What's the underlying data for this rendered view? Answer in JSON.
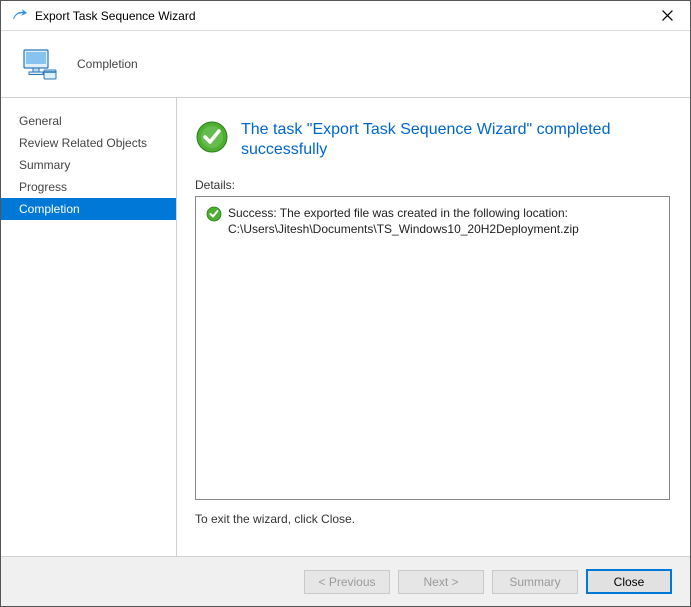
{
  "window": {
    "title": "Export Task Sequence Wizard"
  },
  "header": {
    "stage": "Completion"
  },
  "sidebar": {
    "items": [
      {
        "label": "General"
      },
      {
        "label": "Review Related Objects"
      },
      {
        "label": "Summary"
      },
      {
        "label": "Progress"
      },
      {
        "label": "Completion",
        "selected": true
      }
    ]
  },
  "main": {
    "headline": "The task \"Export Task Sequence Wizard\" completed successfully",
    "details_label": "Details:",
    "details_entries": [
      {
        "status_icon": "success-check-icon",
        "message": "Success: The exported file was created in the following location: C:\\Users\\Jitesh\\Documents\\TS_Windows10_20H2Deployment.zip"
      }
    ],
    "exit_hint": "To exit the wizard, click Close."
  },
  "footer": {
    "previous_label": "< Previous",
    "next_label": "Next >",
    "summary_label": "Summary",
    "close_label": "Close"
  }
}
